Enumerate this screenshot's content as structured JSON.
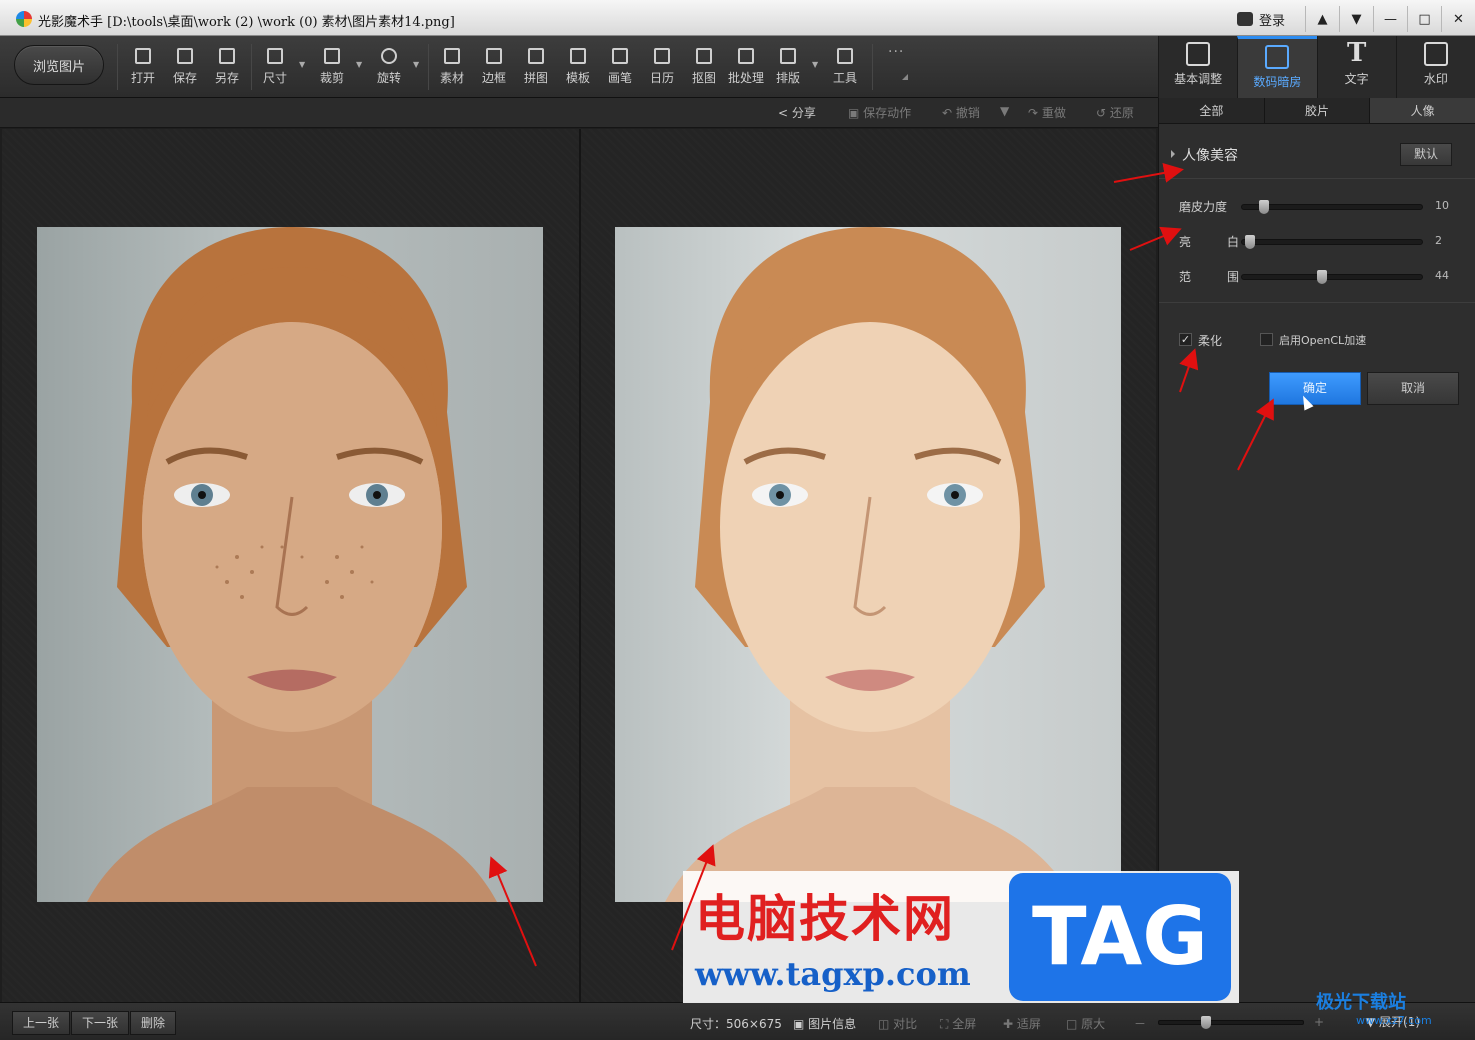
{
  "window": {
    "title": "光影魔术手  [D:\\tools\\桌面\\work (2) \\work (0) 素材\\图片素材14.png]",
    "login": "登录",
    "controls": [
      "shirt-icon",
      "menu-icon",
      "minimize-icon",
      "maximize-icon",
      "close-icon"
    ]
  },
  "toolbar": {
    "browse": "浏览图片",
    "tools": [
      {
        "label": "打开",
        "icon": "open-icon"
      },
      {
        "label": "保存",
        "icon": "save-icon"
      },
      {
        "label": "另存",
        "icon": "save-as-icon"
      },
      {
        "label": "尺寸",
        "icon": "resize-icon"
      },
      {
        "label": "裁剪",
        "icon": "crop-icon"
      },
      {
        "label": "旋转",
        "icon": "rotate-icon"
      },
      {
        "label": "素材",
        "icon": "material-icon"
      },
      {
        "label": "边框",
        "icon": "border-icon"
      },
      {
        "label": "拼图",
        "icon": "collage-icon"
      },
      {
        "label": "模板",
        "icon": "template-icon"
      },
      {
        "label": "画笔",
        "icon": "brush-icon"
      },
      {
        "label": "日历",
        "icon": "calendar-icon"
      },
      {
        "label": "抠图",
        "icon": "cutout-icon"
      },
      {
        "label": "批处理",
        "icon": "batch-icon"
      },
      {
        "label": "排版",
        "icon": "layout-icon"
      },
      {
        "label": "工具",
        "icon": "wrench-icon"
      }
    ],
    "more": "···"
  },
  "right_tabs": [
    {
      "label": "基本调整",
      "icon": "basic-adjust-icon"
    },
    {
      "label": "数码暗房",
      "icon": "camera-icon",
      "active": true
    },
    {
      "label": "文字",
      "icon": "text-icon"
    },
    {
      "label": "水印",
      "icon": "watermark-icon"
    }
  ],
  "actions": {
    "share": "分享",
    "save_action": "保存动作",
    "undo": "撤销",
    "redo": "重做",
    "restore": "还原"
  },
  "panel": {
    "subtabs": [
      "全部",
      "胶片",
      "人像"
    ],
    "active_subtab": "人像",
    "section_title": "人像美容",
    "default_button": "默认",
    "sliders": [
      {
        "label": "磨皮力度",
        "label2": "",
        "value": 10,
        "max": 100
      },
      {
        "label": "亮",
        "label2": "白",
        "value": 2,
        "max": 100
      },
      {
        "label": "范",
        "label2": "围",
        "value": 44,
        "max": 100
      }
    ],
    "soften": {
      "label": "柔化",
      "checked": true
    },
    "opencl": {
      "label": "启用OpenCL加速",
      "checked": false
    },
    "ok": "确定",
    "cancel": "取消"
  },
  "statusbar": {
    "prev": "上一张",
    "next": "下一张",
    "delete": "删除",
    "size": "尺寸：506×675",
    "info": "图片信息",
    "compare": "对比",
    "fullscreen": "全屏",
    "fit": "适屏",
    "original": "原大",
    "zoom_minus": "－",
    "zoom_plus": "+",
    "expand": "展开(1)"
  },
  "watermarks": {
    "title": "电脑技术网",
    "url": "www.tagxp.com",
    "tag": "TAG",
    "site": "极光下载站",
    "site_url": "www.xz7.com"
  },
  "colors": {
    "accent": "#2d8cf0",
    "annotation": "#e01010"
  }
}
